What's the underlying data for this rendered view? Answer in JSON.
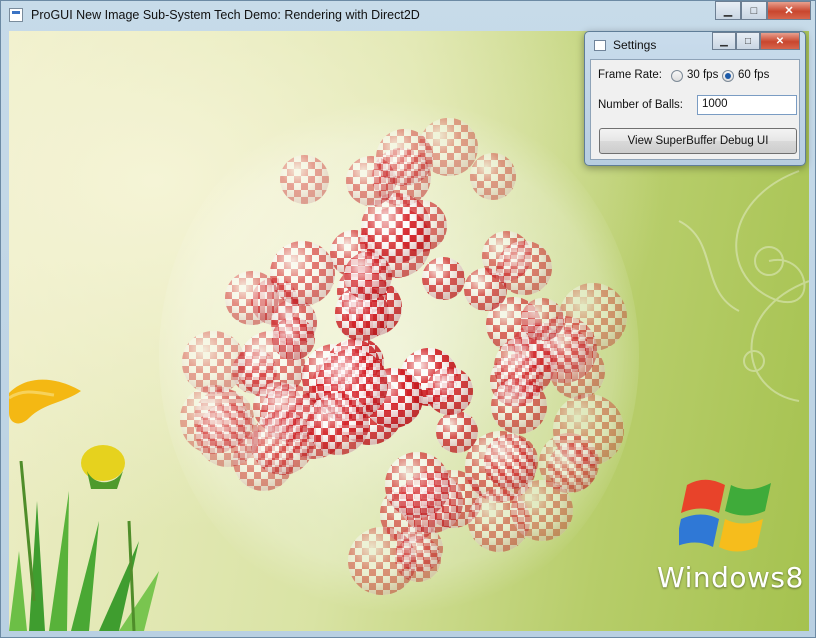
{
  "window": {
    "title": "ProGUI New Image Sub-System Tech Demo: Rendering with Direct2D",
    "minimize_glyph": "▁",
    "maximize_glyph": "□",
    "close_glyph": "✕"
  },
  "wallpaper": {
    "logo_text": "Windows8"
  },
  "settings": {
    "title": "Settings",
    "frame_rate_label": "Frame Rate:",
    "options": [
      "30 fps",
      "60 fps"
    ],
    "selected_option": "60 fps",
    "balls_label": "Number of Balls:",
    "balls_value": "1000",
    "debug_button": "View SuperBuffer Debug UI"
  },
  "colors": {
    "ball_red": "#d8232a",
    "ball_white": "#ffffff",
    "close_red": "#c9462e"
  }
}
